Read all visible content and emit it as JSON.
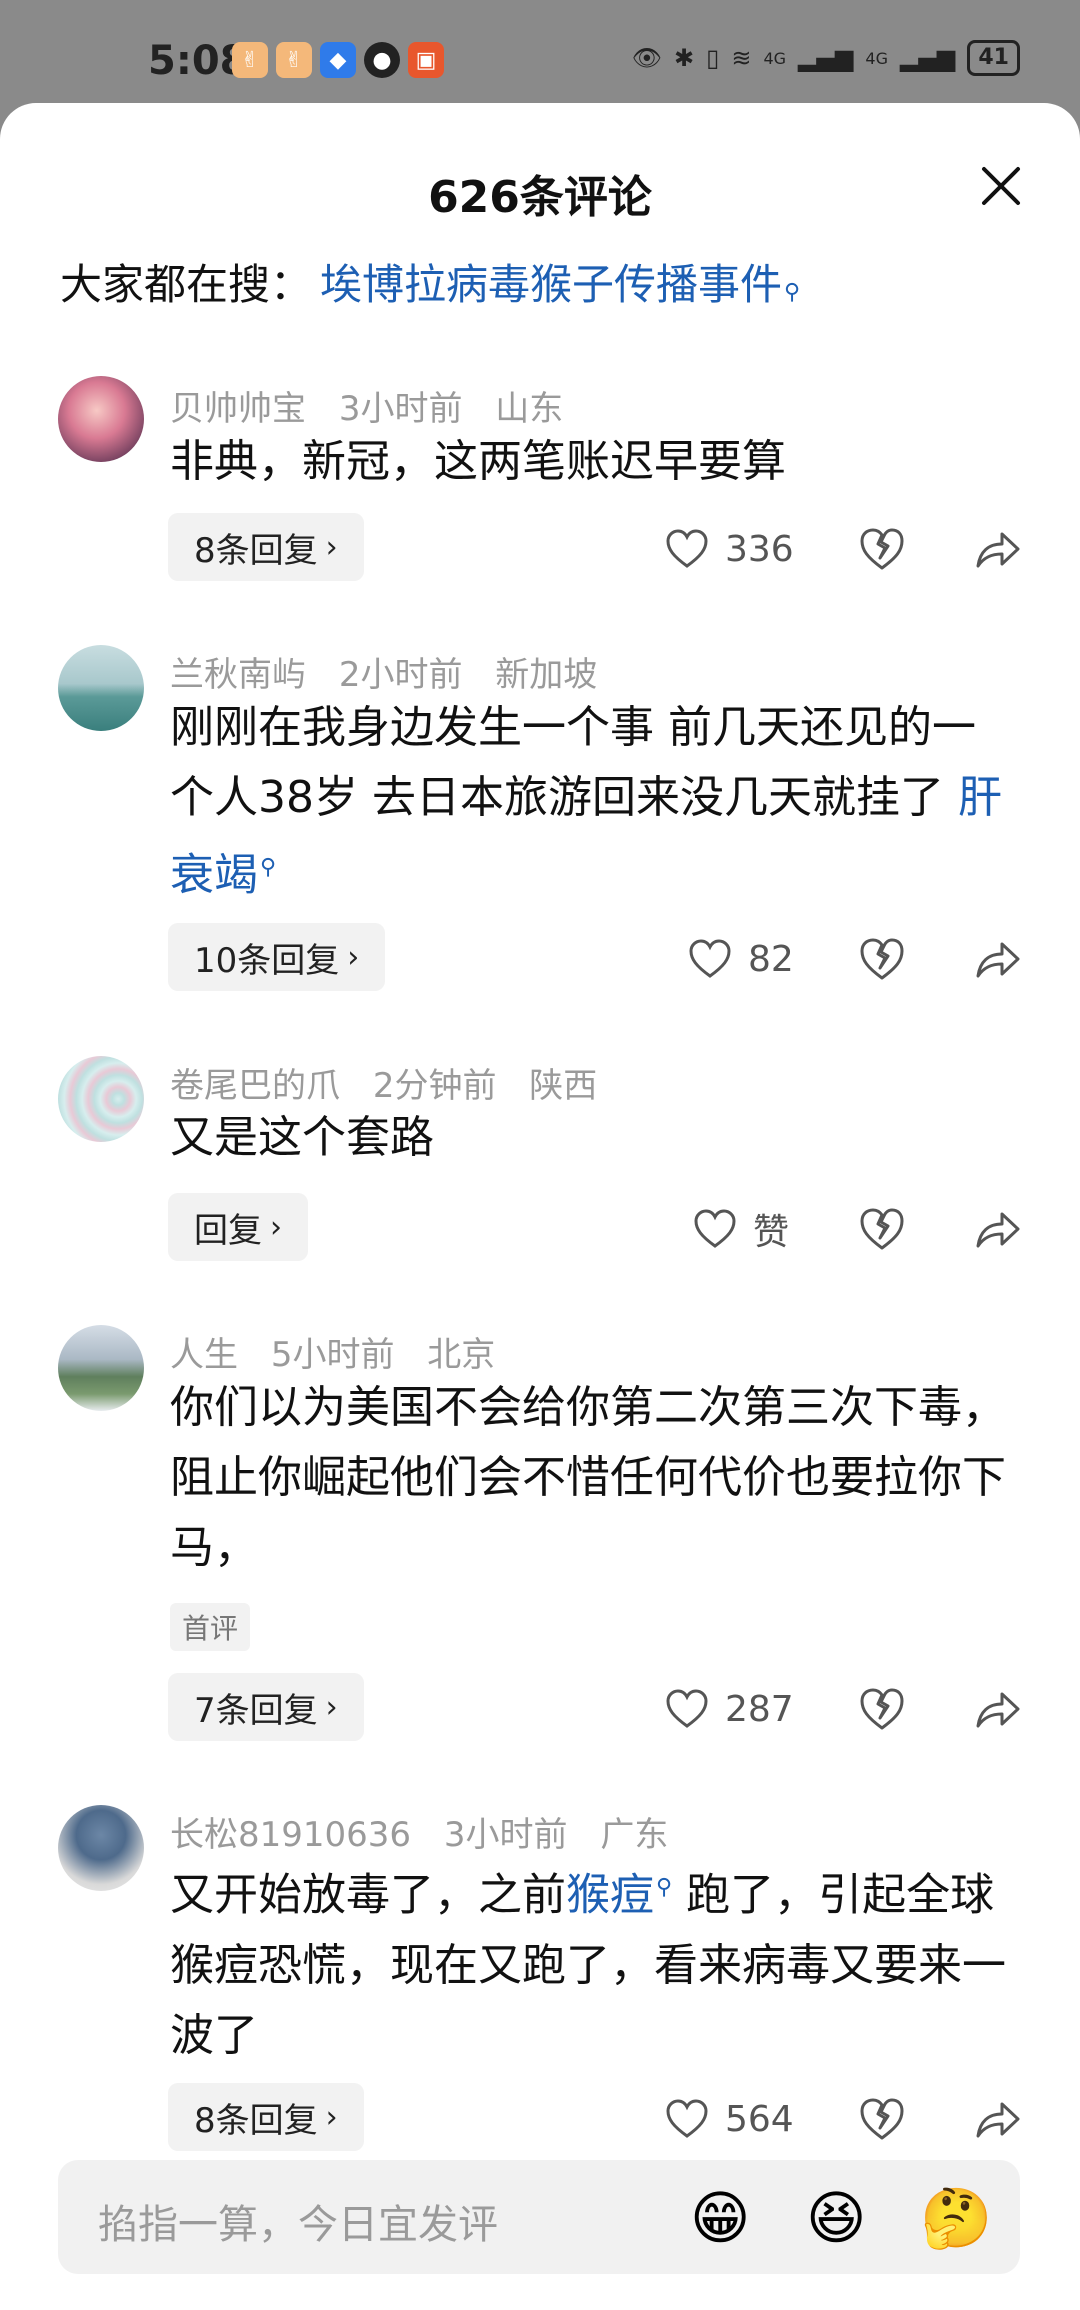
{
  "status": {
    "time": "5:08",
    "net1": "4G",
    "net2": "4G",
    "battery": "41"
  },
  "header": {
    "title": "626条评论"
  },
  "hot_search": {
    "prefix": "大家都在搜：",
    "link": "埃博拉病毒猴子传播事件"
  },
  "comments": [
    {
      "user": "贝帅帅宝",
      "time": "3小时前",
      "location": "山东",
      "text": "非典，新冠，这两笔账迟早要算",
      "replies": "8条回复",
      "likes": "336"
    },
    {
      "user": "兰秋南屿",
      "time": "2小时前",
      "location": "新加坡",
      "text": "刚刚在我身边发生一个事 前几天还见的一个人38岁 去日本旅游回来没几天就挂了 ",
      "keyword": "肝衰竭",
      "replies": "10条回复",
      "likes": "82"
    },
    {
      "user": "卷尾巴的爪",
      "time": "2分钟前",
      "location": "陕西",
      "text": "又是这个套路",
      "replies": "回复",
      "likes": "赞"
    },
    {
      "user": "人生",
      "time": "5小时前",
      "location": "北京",
      "text": "你们以为美国不会给你第二次第三次下毒，阻止你崛起他们会不惜任何代价也要拉你下马，",
      "tag": "首评",
      "replies": "7条回复",
      "likes": "287"
    },
    {
      "user": "长松81910636",
      "time": "3小时前",
      "location": "广东",
      "text_before": "又开始放毒了，之前",
      "keyword": "猴痘",
      "text_after": " 跑了，引起全球猴痘恐慌，现在又跑了，看来病毒又要来一波了",
      "replies": "8条回复",
      "likes": "564"
    }
  ],
  "input": {
    "placeholder": "掐指一算，今日宜发评",
    "emojis": [
      "😁",
      "😆",
      "🤔"
    ]
  }
}
